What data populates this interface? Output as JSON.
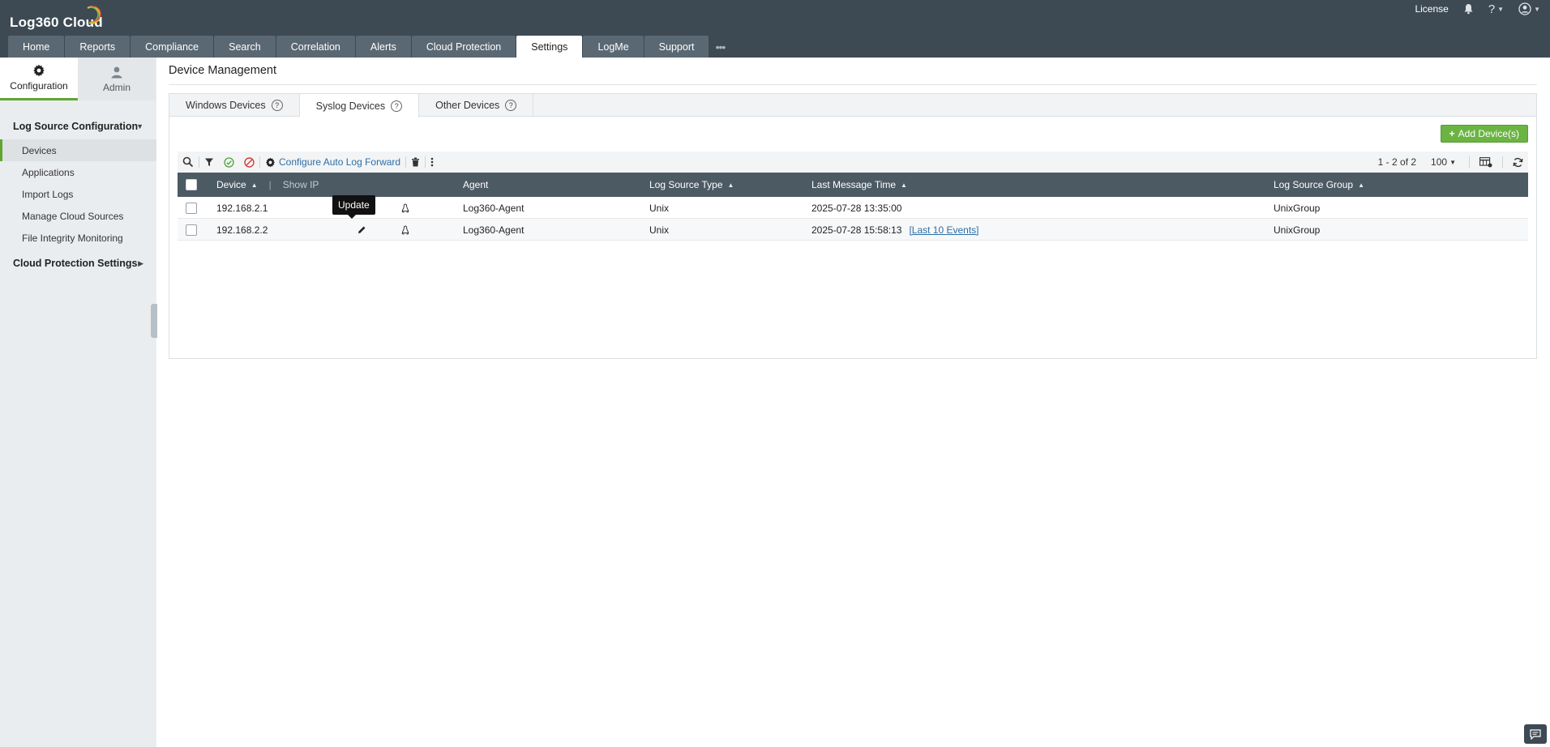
{
  "app": {
    "title": "Log360 Cloud",
    "accent_color": "#5fa530",
    "header_color": "#3d4a54",
    "logo_icon": "log360-swoosh-icon"
  },
  "top_right": {
    "license_label": "License",
    "bell_icon": "bell-icon",
    "help_icon": "help-icon",
    "user_icon": "user-icon"
  },
  "nav": {
    "tabs": [
      {
        "label": "Home"
      },
      {
        "label": "Reports"
      },
      {
        "label": "Compliance"
      },
      {
        "label": "Search"
      },
      {
        "label": "Correlation"
      },
      {
        "label": "Alerts"
      },
      {
        "label": "Cloud Protection"
      },
      {
        "label": "Settings",
        "active": true
      },
      {
        "label": "LogMe"
      },
      {
        "label": "Support"
      }
    ],
    "more_icon": "more-dots-icon"
  },
  "sidebar": {
    "switch": [
      {
        "label": "Configuration",
        "icon": "gear-icon",
        "active": true
      },
      {
        "label": "Admin",
        "icon": "user-icon"
      }
    ],
    "sections": [
      {
        "label": "Log Source Configuration",
        "expanded": true,
        "items": [
          {
            "label": "Devices",
            "active": true
          },
          {
            "label": "Applications"
          },
          {
            "label": "Import Logs"
          },
          {
            "label": "Manage Cloud Sources"
          },
          {
            "label": "File Integrity Monitoring"
          }
        ]
      },
      {
        "label": "Cloud Protection Settings",
        "expanded": false,
        "items": []
      }
    ]
  },
  "main": {
    "title": "Device Management",
    "device_tabs": [
      {
        "label": "Windows Devices"
      },
      {
        "label": "Syslog Devices",
        "active": true
      },
      {
        "label": "Other Devices"
      }
    ],
    "add_button": "Add Device(s)",
    "add_button_color": "#6bb443",
    "toolbar": {
      "configure_label": "Configure Auto Log Forward",
      "pager": "1 - 2 of 2",
      "per_page": "100"
    },
    "table": {
      "columns": {
        "device": "Device",
        "show_ip": "Show IP",
        "agent": "Agent",
        "log_source_type": "Log Source Type",
        "last_message_time": "Last Message Time",
        "log_source_group": "Log Source Group"
      },
      "rows": [
        {
          "device": "192.168.2.1",
          "agent": "Log360-Agent",
          "type": "Unix",
          "last_time": "2025-07-28 13:35:00",
          "events_link": "",
          "group": "UnixGroup"
        },
        {
          "device": "192.168.2.2",
          "agent": "Log360-Agent",
          "type": "Unix",
          "last_time": "2025-07-28 15:58:13",
          "events_link": "[Last 10 Events]",
          "group": "UnixGroup"
        }
      ]
    },
    "tooltip": "Update"
  }
}
